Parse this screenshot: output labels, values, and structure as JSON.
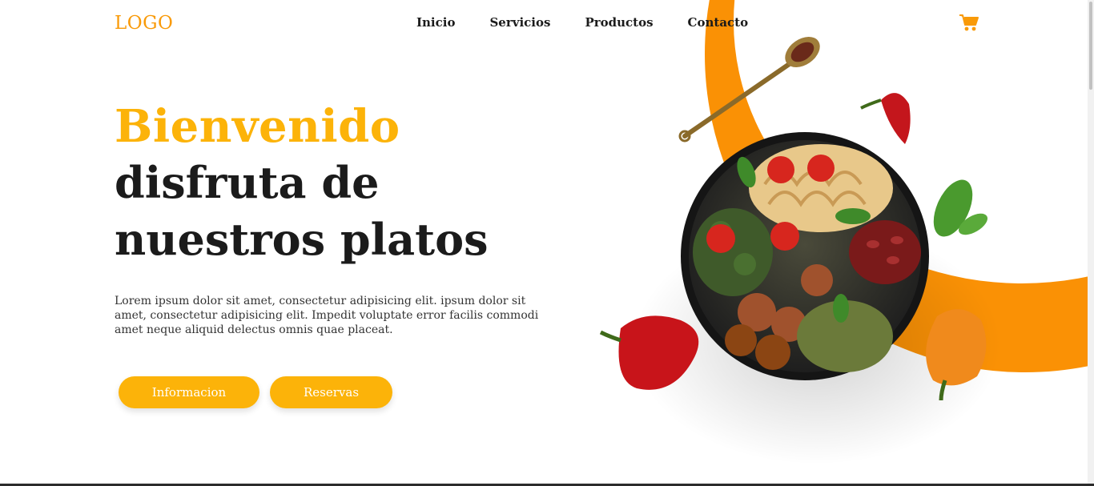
{
  "header": {
    "logo": "LOGO",
    "nav": [
      {
        "label": "Inicio"
      },
      {
        "label": "Servicios"
      },
      {
        "label": "Productos"
      },
      {
        "label": "Contacto"
      }
    ],
    "cart_icon": "shopping-cart-icon"
  },
  "hero": {
    "title_line1": "Bienvenido",
    "title_line2": "disfruta de",
    "title_line3": "nuestros platos",
    "description": "Lorem ipsum dolor sit amet, consectetur adipisicing elit. ipsum dolor sit amet, consectetur adipisicing elit. Impedit voluptate error facilis commodi amet neque aliquid delectus omnis quae placeat.",
    "buttons": {
      "info": "Informacion",
      "reservations": "Reservas"
    }
  },
  "colors": {
    "accent": "#fcb309",
    "orange_arc": "#fa9105",
    "logo": "#f99a08",
    "text_dark": "#1b1b1b"
  }
}
